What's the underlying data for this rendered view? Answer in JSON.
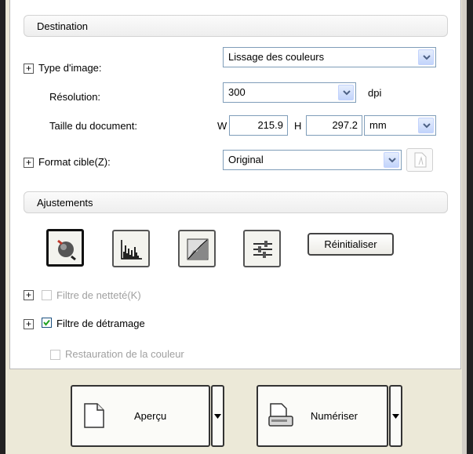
{
  "destination": {
    "header": "Destination",
    "image_type_label": "Type d'image:",
    "image_type_value": "Lissage des couleurs",
    "resolution_label": "Résolution:",
    "resolution_value": "300",
    "resolution_unit": "dpi",
    "doc_size_label": "Taille du document:",
    "w_label": "W",
    "w_value": "215.9",
    "h_label": "H",
    "h_value": "297.2",
    "size_unit": "mm",
    "target_format_label": "Format cible(Z):",
    "target_format_value": "Original"
  },
  "adjustments": {
    "header": "Ajustements",
    "reset_label": "Réinitialiser",
    "sharpen_label": "Filtre de netteté(K)",
    "sharpen_checked": false,
    "descreen_label": "Filtre de détramage",
    "descreen_checked": true,
    "color_restore_label": "Restauration de la couleur",
    "color_restore_checked": false
  },
  "footer": {
    "preview_label": "Aperçu",
    "scan_label": "Numériser"
  },
  "icons": [
    "plus-expand-icon",
    "dropdown-arrow-icon",
    "auto-exposure-icon",
    "histogram-icon",
    "tone-curve-icon",
    "color-balance-icon",
    "page-icon",
    "scanner-icon",
    "split-arrow-icon"
  ]
}
